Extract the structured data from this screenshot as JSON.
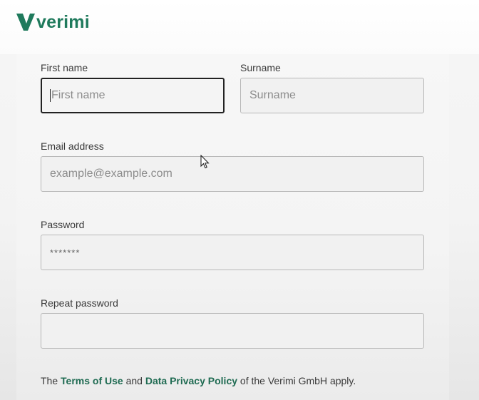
{
  "brand": {
    "name": "verimi",
    "color": "#1f7a5c"
  },
  "form": {
    "first_name": {
      "label": "First name",
      "placeholder": "First name"
    },
    "surname": {
      "label": "Surname",
      "placeholder": "Surname"
    },
    "email": {
      "label": "Email address",
      "placeholder": "example@example.com"
    },
    "password": {
      "label": "Password",
      "value": "*******"
    },
    "repeat_password": {
      "label": "Repeat password",
      "value": ""
    }
  },
  "footer": {
    "prefix": "The ",
    "terms_link": "Terms of Use",
    "and": " and ",
    "privacy_link": "Data Privacy Policy",
    "suffix": " of the Verimi GmbH apply."
  },
  "icons": {
    "logo": "verimi-v-logo-icon",
    "pointer": "mouse-pointer-icon"
  }
}
